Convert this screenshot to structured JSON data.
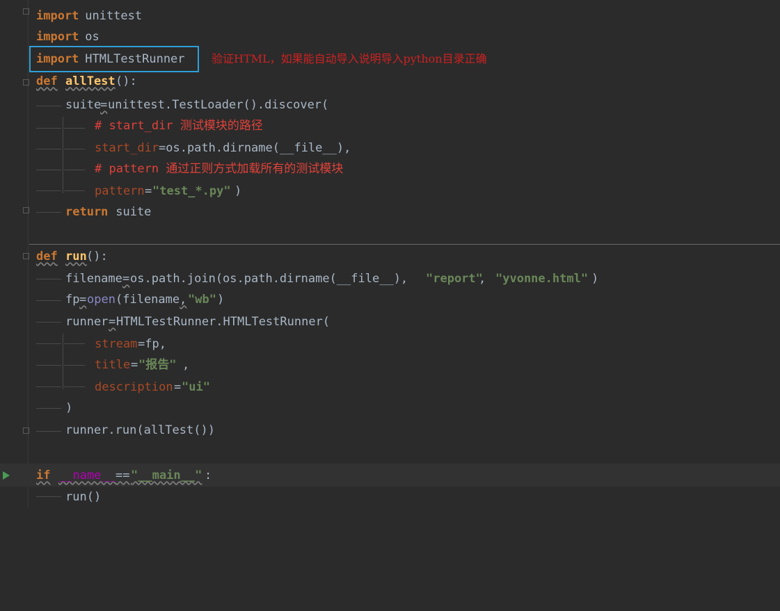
{
  "editor": {
    "lines": {
      "l1": {
        "kw": "import",
        "rest": " unittest"
      },
      "l2": {
        "kw": "import",
        "rest": " os"
      },
      "l3": {
        "kw": "import",
        "rest": " HTMLTestRunner"
      },
      "annotation": "验证HTML，如果能自动导入说明导入python目录正确",
      "l4": {
        "kw": "def",
        "name": "allTest",
        "rest": "():"
      },
      "l5": {
        "a": "suite",
        "b": "=",
        "c": "unittest.TestLoader().discover("
      },
      "l6": {
        "c": "# start_dir 测试模块的路径"
      },
      "l7": {
        "p": "start_dir",
        "r": "=os.path.dirname(__file__),"
      },
      "l8": {
        "c": "# pattern 通过正则方式加载所有的测试模块"
      },
      "l9": {
        "p": "pattern",
        "eq": "=",
        "s": "\"test_*.py\"",
        "r": ")"
      },
      "l10": {
        "kw": "return",
        "rest": " suite"
      },
      "l11": {
        "kw": "def",
        "name": "run",
        "rest": "():"
      },
      "l12": {
        "a": "filename",
        "b": "=",
        "c": "os.path.join(os.path.dirname(__file__), ",
        "s1": "\"report\"",
        "comma": ", ",
        "s2": "\"yvonne.html\"",
        "end": ")"
      },
      "l13": {
        "a": "fp",
        "b": "=",
        "bi": "open",
        "c": "(filename",
        "comma": ",",
        "s": "\"wb\"",
        "end": ")"
      },
      "l14": {
        "a": "runner",
        "b": "=",
        "c": "HTMLTestRunner.HTMLTestRunner("
      },
      "l15": {
        "p": "stream",
        "r": "=fp,"
      },
      "l16": {
        "p": "title",
        "eq": "=",
        "s": "\"报告\"",
        "r": ","
      },
      "l17": {
        "p": "description",
        "eq": "=",
        "s": "\"ui\""
      },
      "l18": {
        "r": ")"
      },
      "l19": {
        "r": "runner.run(allTest())"
      },
      "l20": {
        "kw": "if",
        "sp": " ",
        "d": "__name__",
        "eq": "==",
        "s": "\"__main__\"",
        "colon": ":"
      },
      "l21": {
        "r": "run()"
      }
    }
  }
}
